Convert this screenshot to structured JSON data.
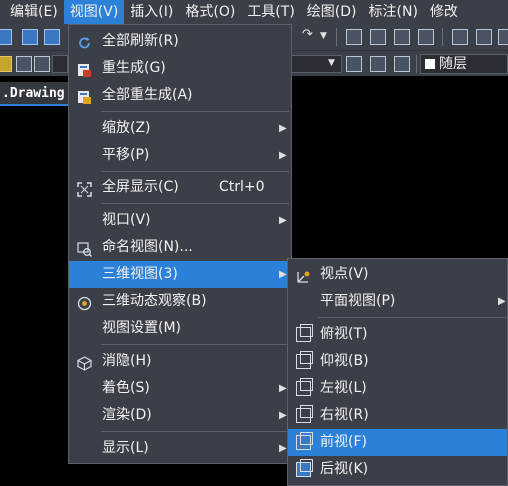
{
  "menubar": {
    "items": [
      "编辑(E)",
      "视图(V)",
      "插入(I)",
      "格式(O)",
      "工具(T)",
      "绘图(D)",
      "标注(N)",
      "修改"
    ]
  },
  "toolbar": {
    "layer_value": "随层"
  },
  "drawing_tab": ".Drawing",
  "view_menu": {
    "items": [
      {
        "label": "全部刷新(R)",
        "icon": "refresh-icon"
      },
      {
        "label": "重生成(G)",
        "icon": "regen-icon"
      },
      {
        "label": "全部重生成(A)",
        "icon": "regen-all-icon"
      },
      {
        "label": "缩放(Z)"
      },
      {
        "label": "平移(P)"
      },
      {
        "label": "全屏显示(C)",
        "shortcut": "Ctrl+0",
        "icon": "fullscreen-icon"
      },
      {
        "label": "视口(V)"
      },
      {
        "label": "命名视图(N)...",
        "icon": "named-view-icon"
      },
      {
        "label": "三维视图(3)"
      },
      {
        "label": "三维动态观察(B)",
        "icon": "orbit-icon"
      },
      {
        "label": "视图设置(M)"
      },
      {
        "label": "消隐(H)",
        "icon": "hide-icon"
      },
      {
        "label": "着色(S)"
      },
      {
        "label": "渲染(D)"
      },
      {
        "label": "显示(L)"
      }
    ]
  },
  "sub_menu": {
    "items": [
      {
        "label": "视点(V)",
        "icon": "viewpoint-icon"
      },
      {
        "label": "平面视图(P)"
      },
      {
        "label": "俯视(T)",
        "icon": "top-view-icon"
      },
      {
        "label": "仰视(B)",
        "icon": "bottom-view-icon"
      },
      {
        "label": "左视(L)",
        "icon": "left-view-icon"
      },
      {
        "label": "右视(R)",
        "icon": "right-view-icon"
      },
      {
        "label": "前视(F)",
        "icon": "front-view-icon"
      },
      {
        "label": "后视(K)",
        "icon": "back-view-icon"
      }
    ]
  },
  "colors": {
    "highlight": "#2b80d8",
    "menu_bg": "#3b3f47",
    "canvas_bg": "#000000"
  }
}
